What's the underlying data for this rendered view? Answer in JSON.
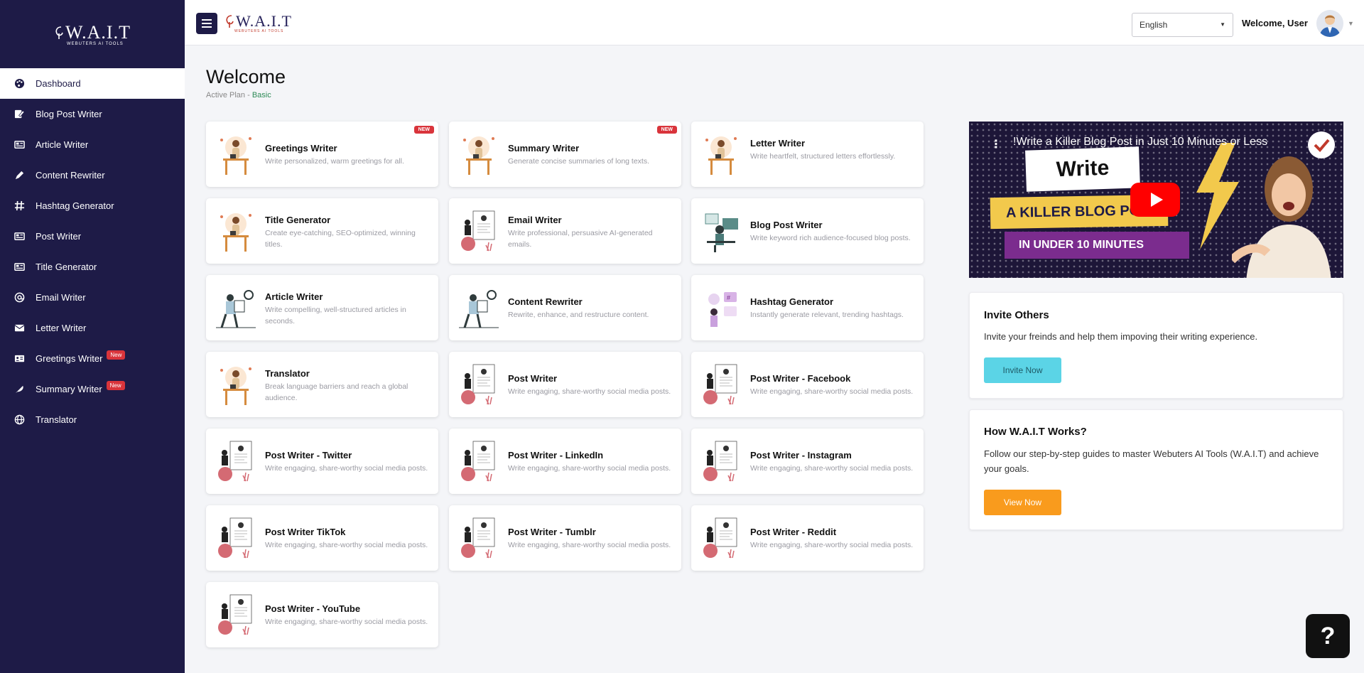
{
  "brand": {
    "name": "W.A.I.T",
    "tagline": "WEBUTERS AI TOOLS"
  },
  "sidebar": {
    "items": [
      {
        "label": "Dashboard",
        "icon": "palette-icon",
        "active": true
      },
      {
        "label": "Blog Post Writer",
        "icon": "edit-icon"
      },
      {
        "label": "Article Writer",
        "icon": "newspaper-icon"
      },
      {
        "label": "Content Rewriter",
        "icon": "pen-icon"
      },
      {
        "label": "Hashtag Generator",
        "icon": "hashtag-icon"
      },
      {
        "label": "Post Writer",
        "icon": "newspaper-icon"
      },
      {
        "label": "Title Generator",
        "icon": "newspaper-icon"
      },
      {
        "label": "Email Writer",
        "icon": "at-icon"
      },
      {
        "label": "Letter Writer",
        "icon": "envelope-icon"
      },
      {
        "label": "Greetings Writer",
        "icon": "id-card-icon",
        "badge": "New"
      },
      {
        "label": "Summary Writer",
        "icon": "feather-icon",
        "badge": "New"
      },
      {
        "label": "Translator",
        "icon": "globe-icon"
      }
    ]
  },
  "header": {
    "language": "English",
    "welcome": "Welcome, User"
  },
  "page": {
    "title": "Welcome",
    "plan_label": "Active Plan - ",
    "plan_value": "Basic"
  },
  "tools": [
    {
      "title": "Greetings Writer",
      "desc": "Write personalized, warm greetings for all.",
      "badge": "NEW",
      "illus": "desk-person-illustration"
    },
    {
      "title": "Summary Writer",
      "desc": "Generate concise summaries of long texts.",
      "badge": "NEW",
      "illus": "desk-person-illustration"
    },
    {
      "title": "Letter Writer",
      "desc": "Write heartfelt, structured letters effortlessly.",
      "illus": "desk-person-illustration"
    },
    {
      "title": "Title Generator",
      "desc": "Create eye-catching, SEO-optimized, winning titles.",
      "illus": "desk-person-illustration"
    },
    {
      "title": "Email Writer",
      "desc": "Write professional, persuasive AI-generated emails.",
      "illus": "document-person-illustration"
    },
    {
      "title": "Blog Post Writer",
      "desc": "Write keyword rich audience-focused blog posts.",
      "illus": "blogger-illustration"
    },
    {
      "title": "Article Writer",
      "desc": "Write compelling, well-structured articles in seconds.",
      "illus": "reading-person-illustration"
    },
    {
      "title": "Content Rewriter",
      "desc": "Rewrite, enhance, and restructure content.",
      "illus": "reading-person-illustration"
    },
    {
      "title": "Hashtag Generator",
      "desc": "Instantly generate relevant, trending hashtags.",
      "illus": "hashtag-illustration"
    },
    {
      "title": "Translator",
      "desc": "Break language barriers and reach a global audience.",
      "illus": "desk-person-illustration"
    },
    {
      "title": "Post Writer",
      "desc": "Write engaging, share-worthy social media posts.",
      "illus": "document-person-illustration"
    },
    {
      "title": "Post Writer - Facebook",
      "desc": "Write engaging, share-worthy social media posts.",
      "illus": "document-person-illustration"
    },
    {
      "title": "Post Writer - Twitter",
      "desc": "Write engaging, share-worthy social media posts.",
      "illus": "document-person-illustration"
    },
    {
      "title": "Post Writer - LinkedIn",
      "desc": "Write engaging, share-worthy social media posts.",
      "illus": "document-person-illustration"
    },
    {
      "title": "Post Writer - Instagram",
      "desc": "Write engaging, share-worthy social media posts.",
      "illus": "document-person-illustration"
    },
    {
      "title": "Post Writer TikTok",
      "desc": "Write engaging, share-worthy social media posts.",
      "illus": "document-person-illustration"
    },
    {
      "title": "Post Writer - Tumblr",
      "desc": "Write engaging, share-worthy social media posts.",
      "illus": "document-person-illustration"
    },
    {
      "title": "Post Writer - Reddit",
      "desc": "Write engaging, share-worthy social media posts.",
      "illus": "document-person-illustration"
    },
    {
      "title": "Post Writer - YouTube",
      "desc": "Write engaging, share-worthy social media posts.",
      "illus": "document-person-illustration"
    }
  ],
  "video": {
    "title": "!Write a Killer Blog Post in Just 10 Minutes or Less",
    "banner_word": "Write",
    "banner_line1": "A KILLER BLOG PO",
    "banner_line2": "IN UNDER 10 MINUTES"
  },
  "invite": {
    "title": "Invite Others",
    "text": "Invite your freinds and help them impoving their writing experience.",
    "button": "Invite Now"
  },
  "how": {
    "title": "How W.A.I.T Works?",
    "text": "Follow our step-by-step guides to master Webuters AI Tools (W.A.I.T) and achieve your goals.",
    "button": "View Now"
  },
  "help": {
    "label": "?"
  },
  "colors": {
    "sidebar_bg": "#1e1b47",
    "new_badge": "#d9343b",
    "invite_btn": "#5bd4e6",
    "view_btn": "#f99b1d",
    "plan_value": "#2e8b57"
  }
}
